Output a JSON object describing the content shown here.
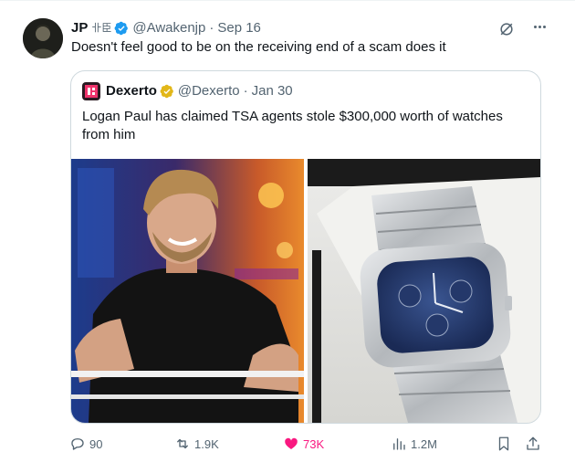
{
  "tweet": {
    "author_name": "JP",
    "author_glyphs": "卝⾂",
    "handle": "@Awakenjp",
    "separator": "·",
    "date": "Sep 16",
    "text": "Doesn't feel good to be on the receiving end of a scam does it"
  },
  "quote": {
    "author_name": "Dexerto",
    "handle": "@Dexerto",
    "separator": "·",
    "date": "Jan 30",
    "text": "Logan Paul has claimed TSA agents stole $300,000 worth of watches from him"
  },
  "actions": {
    "replies": "90",
    "reposts": "1.9K",
    "likes": "73K",
    "views": "1.2M"
  },
  "colors": {
    "accent": "#1d9bf0",
    "like": "#f91880",
    "muted": "#536471",
    "gold_badge": "#e2b719",
    "border": "#cfd9de"
  },
  "icons": [
    "verified-badge-icon",
    "grok-icon",
    "more-icon",
    "reply-icon",
    "repost-icon",
    "heart-icon",
    "views-icon",
    "bookmark-icon",
    "share-icon"
  ]
}
